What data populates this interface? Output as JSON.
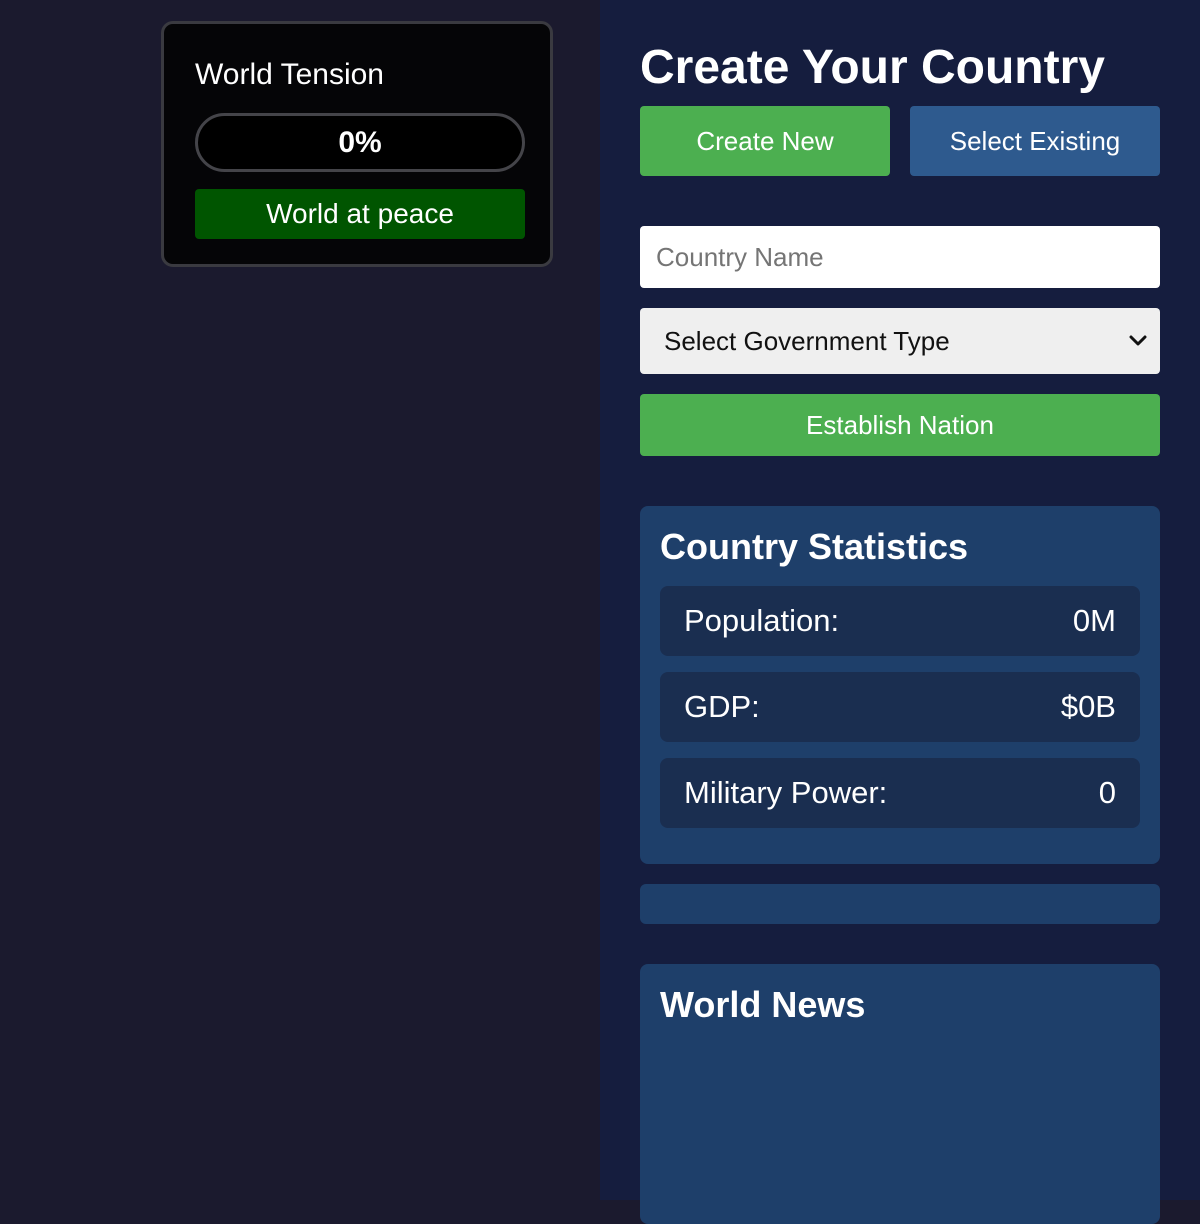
{
  "world_tension": {
    "title": "World Tension",
    "value_text": "0%",
    "level": 0,
    "status": "World at peace",
    "status_color": "#005500"
  },
  "create_country": {
    "title": "Create Your Country",
    "create_new_label": "Create New",
    "select_existing_label": "Select Existing",
    "country_name_placeholder": "Country Name",
    "country_name_value": "",
    "government_type_selected": "Select Government Type",
    "establish_label": "Establish Nation"
  },
  "stats": {
    "title": "Country Statistics",
    "rows": [
      {
        "label": "Population:",
        "value": "0M"
      },
      {
        "label": "GDP:",
        "value": "$0B"
      },
      {
        "label": "Military Power:",
        "value": "0"
      }
    ]
  },
  "news": {
    "title": "World News"
  },
  "colors": {
    "accent_green": "#4caf50",
    "accent_blue": "#2e5a8e",
    "panel_blue": "#1e3f6a",
    "background_left": "#1b1a2e",
    "background_right": "#151d3e"
  },
  "icons": {
    "select_chevron": "chevron-down-icon"
  }
}
